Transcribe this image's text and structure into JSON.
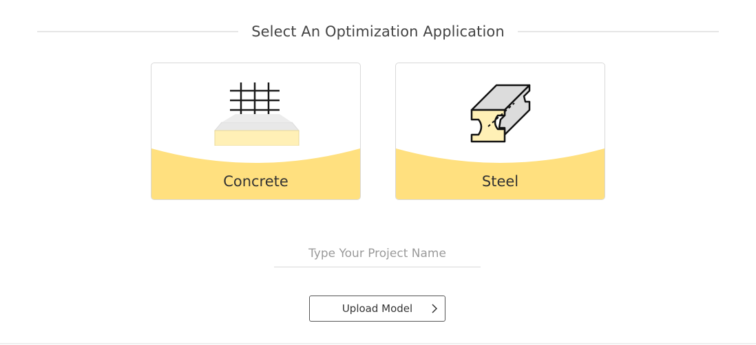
{
  "header": {
    "title": "Select An Optimization Application"
  },
  "cards": [
    {
      "label": "Concrete",
      "icon": "concrete-slab-icon"
    },
    {
      "label": "Steel",
      "icon": "steel-ibeam-icon"
    }
  ],
  "project": {
    "placeholder": "Type Your Project Name",
    "value": ""
  },
  "upload": {
    "label": "Upload Model",
    "icon": "chevron-right-icon"
  },
  "colors": {
    "accent": "#ffe07f",
    "card_border": "#d8d8d8",
    "text": "#333333"
  }
}
